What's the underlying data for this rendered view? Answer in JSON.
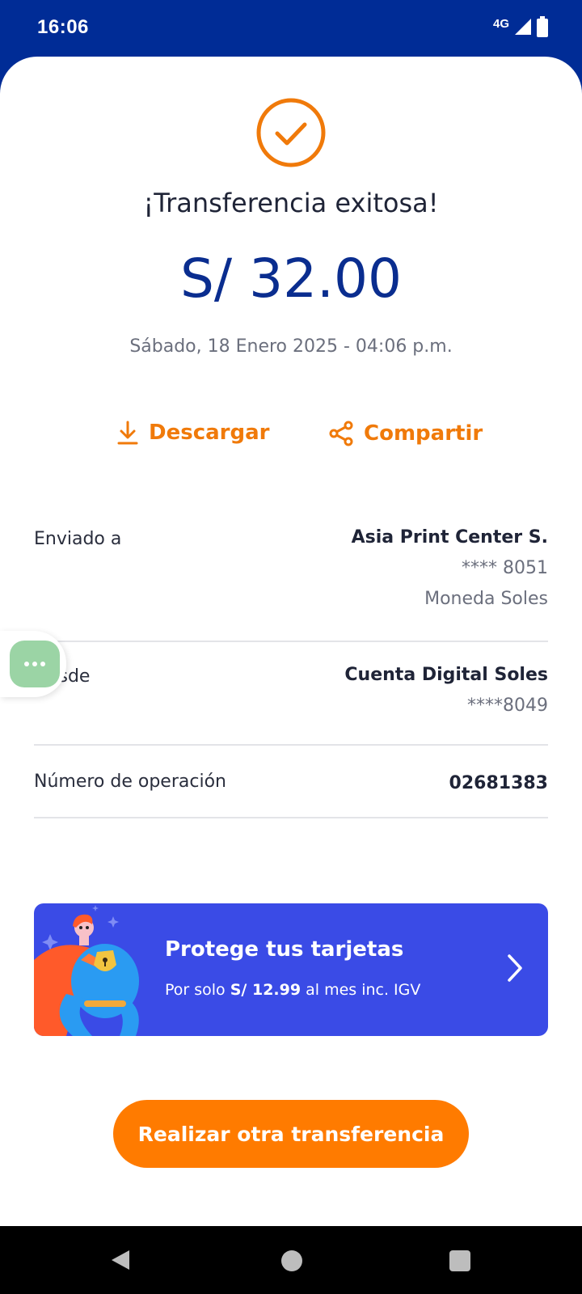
{
  "status_bar": {
    "time": "16:06",
    "network": "4G",
    "icons": [
      "signal-icon",
      "battery-icon"
    ]
  },
  "receipt": {
    "title": "¡Transferencia exitosa!",
    "amount": "S/ 32.00",
    "date": "Sábado, 18 Enero 2025 - 04:06 p.m.",
    "actions": {
      "download_label": "Descargar",
      "share_label": "Compartir"
    }
  },
  "details": {
    "sent_to": {
      "label": "Enviado a",
      "name": "Asia Print Center S.",
      "account": "**** 8051",
      "currency": "Moneda Soles"
    },
    "from": {
      "label": "Desde",
      "name": "Cuenta Digital Soles",
      "account": "****8049"
    },
    "operation": {
      "label": "Número de operación",
      "value": "02681383"
    }
  },
  "promo": {
    "title": "Protege tus tarjetas",
    "sub_prefix": "Por solo ",
    "sub_price": "S/ 12.99",
    "sub_suffix": " al mes inc. IGV"
  },
  "primary_button": {
    "label": "Realizar otra transferencia"
  },
  "colors": {
    "brand_blue": "#002c96",
    "accent_orange": "#ff7b00",
    "promo_blue": "#3a4be6"
  }
}
